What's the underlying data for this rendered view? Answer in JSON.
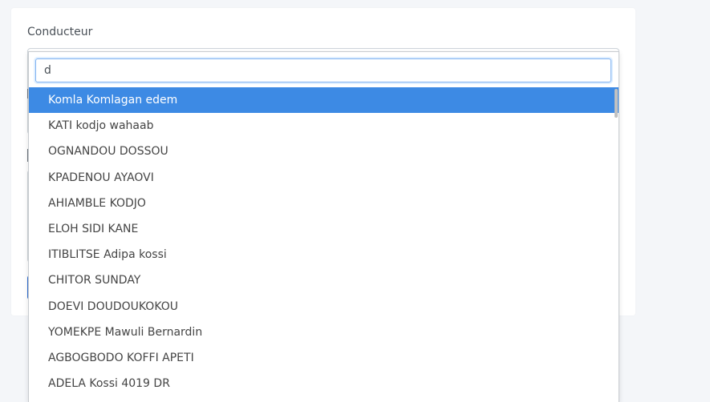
{
  "form": {
    "driver_label": "Conducteur"
  },
  "dropdown": {
    "search_value": "d",
    "options": [
      "Komla Komlagan edem",
      "KATI kodjo wahaab",
      "OGNANDOU DOSSOU",
      "KPADENOU AYAOVI",
      "AHIAMBLE KODJO",
      "ELOH SIDI KANE",
      "ITIBLITSE Adipa kossi",
      "CHITOR SUNDAY",
      "DOEVI DOUDOUKOKOU",
      "YOMEKPE Mawuli Bernardin",
      "AGBOGBODO KOFFI APETI",
      "ADELA Kossi 4019 DR"
    ],
    "highlighted_index": 0
  },
  "colors": {
    "highlight": "#3d8ae4",
    "page_bg": "#f4f6f9"
  }
}
